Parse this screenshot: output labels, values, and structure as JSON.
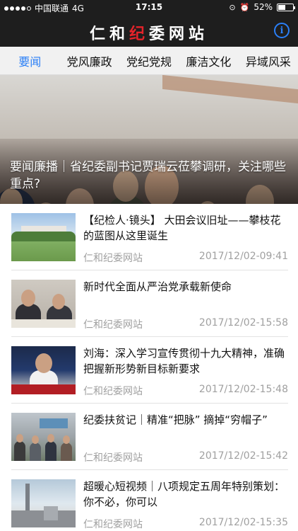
{
  "status_bar": {
    "carrier": "中国联通",
    "network": "4G",
    "time": "17:15",
    "battery": "52%",
    "battery_level": 0.52,
    "signal_dots_filled": 4,
    "signal_dots_total": 5
  },
  "header": {
    "title_part1": "仁和",
    "title_part2": "纪",
    "title_part3": "委网站",
    "title_accent_color": "#e5232a",
    "info_icon": "info-icon",
    "info_glyph": "i"
  },
  "tabs": [
    {
      "label": "要闻",
      "active": true
    },
    {
      "label": "党风廉政",
      "active": false
    },
    {
      "label": "党纪党规",
      "active": false
    },
    {
      "label": "廉洁文化",
      "active": false
    },
    {
      "label": "异域风采",
      "active": false
    }
  ],
  "accent_color": "#2a7ff6",
  "hero": {
    "caption": "要闻廉播｜省纪委副书记贾瑞云莅攀调研，关注哪些重点?"
  },
  "news": [
    {
      "headline": "【纪检人·镜头】 大田会议旧址——攀枝花的蓝图从这里诞生",
      "source": "仁和纪委网站",
      "date": "2017/12/02-09:41"
    },
    {
      "headline": "新时代全面从严治党承载新使命",
      "source": "仁和纪委网站",
      "date": "2017/12/02-15:58"
    },
    {
      "headline": "刘海：深入学习宣传贯彻十九大精神，准确把握新形势新目标新要求",
      "source": "仁和纪委网站",
      "date": "2017/12/02-15:48"
    },
    {
      "headline": "纪委扶贫记｜精准“把脉” 摘掉“穷帽子”",
      "source": "仁和纪委网站",
      "date": "2017/12/02-15:42"
    },
    {
      "headline": "超暖心短视频｜八项规定五周年特别策划：你不必，你可以",
      "source": "仁和纪委网站",
      "date": "2017/12/02-15:35"
    }
  ]
}
